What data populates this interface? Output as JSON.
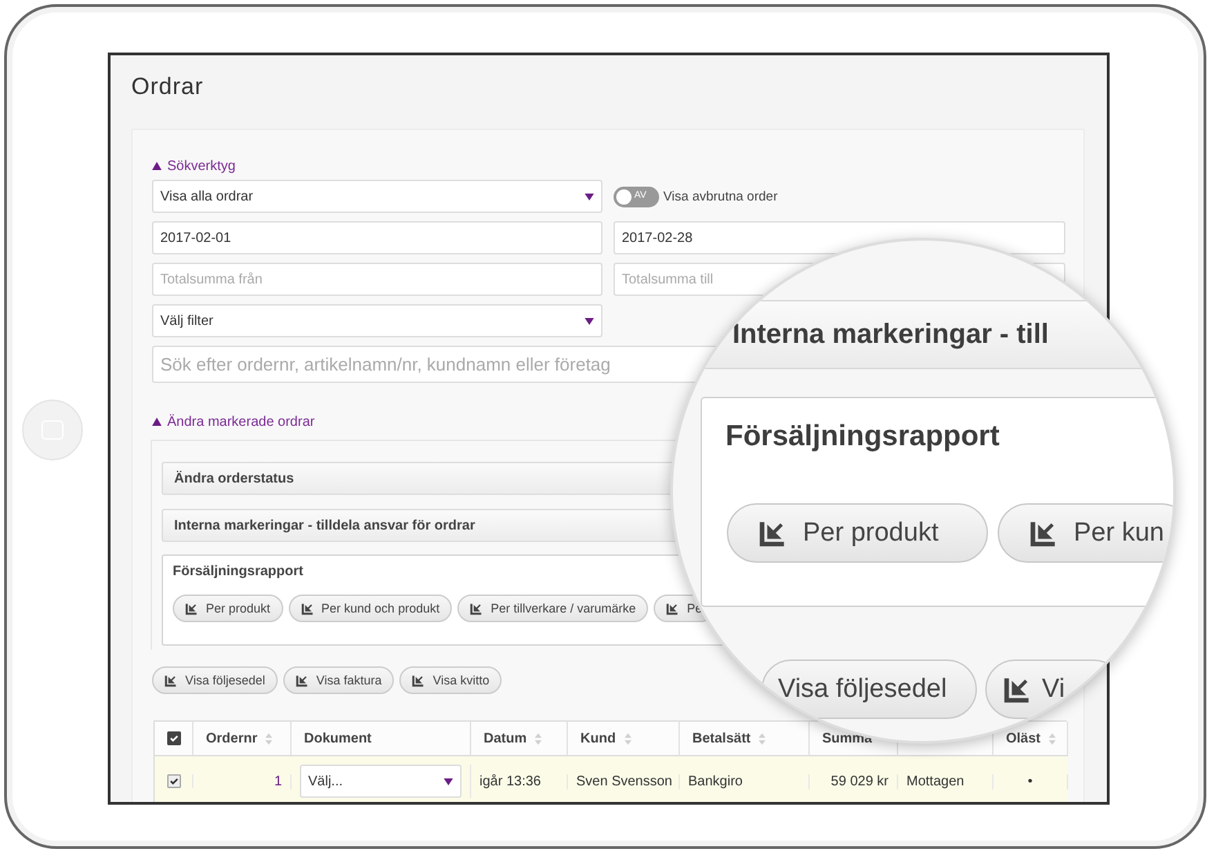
{
  "page": {
    "title": "Ordrar"
  },
  "search_tools": {
    "heading": "Sökverktyg",
    "expanded": true,
    "order_filter": {
      "value": "Visa alla ordrar"
    },
    "cancelled_toggle": {
      "on": false,
      "state_label": "AV",
      "label": "Visa avbrutna order"
    },
    "date_from": {
      "value": "2017-02-01"
    },
    "date_to": {
      "value": "2017-02-28"
    },
    "total_from": {
      "placeholder": "Totalsumma från"
    },
    "total_to": {
      "placeholder": "Totalsumma till"
    },
    "filter": {
      "value": "Välj filter"
    },
    "search": {
      "placeholder": "Sök efter ordernr, artikelnamn/nr, kundnamn eller företag"
    }
  },
  "bulk_actions": {
    "heading": "Ändra markerade ordrar",
    "expanded": true,
    "bars": [
      "Ändra orderstatus",
      "Interna markeringar - tilldela ansvar för ordrar"
    ],
    "report": {
      "title": "Försäljningsrapport",
      "buttons": [
        "Per produkt",
        "Per kund och produkt",
        "Per tillverkare / varumärke",
        "Pe"
      ]
    },
    "document_buttons": [
      "Visa följesedel",
      "Visa faktura",
      "Visa kvitto"
    ]
  },
  "table": {
    "columns": [
      {
        "kind": "checkbox",
        "checked": true
      },
      {
        "kind": "label",
        "label": "Ordernr",
        "sortable": true
      },
      {
        "kind": "label",
        "label": "Dokument",
        "sortable": false
      },
      {
        "kind": "label",
        "label": "Datum",
        "sortable": true
      },
      {
        "kind": "label",
        "label": "Kund",
        "sortable": true
      },
      {
        "kind": "label",
        "label": "Betalsätt",
        "sortable": true
      },
      {
        "kind": "label",
        "label": "Summa"
      },
      {
        "kind": "blank"
      },
      {
        "kind": "label",
        "label": "Oläst",
        "sortable": true
      }
    ],
    "rows": [
      {
        "selected": true,
        "cells": [
          {
            "kind": "checkbox",
            "checked": true
          },
          {
            "kind": "link",
            "text": "1"
          },
          {
            "kind": "select",
            "value": "Välj..."
          },
          {
            "kind": "text",
            "text": "igår 13:36"
          },
          {
            "kind": "text",
            "text": "Sven Svensson"
          },
          {
            "kind": "text",
            "text": "Bankgiro"
          },
          {
            "kind": "number",
            "text": "59 029 kr"
          },
          {
            "kind": "text",
            "text": "Mottagen"
          },
          {
            "kind": "center",
            "text": "•"
          }
        ]
      }
    ]
  },
  "magnifier": {
    "bar": "Interna markeringar - till",
    "report_title": "Försäljningsrapport",
    "report_buttons": [
      "Per produkt",
      "Per kun"
    ],
    "document_buttons": [
      "Visa följesedel",
      "Vi"
    ]
  }
}
